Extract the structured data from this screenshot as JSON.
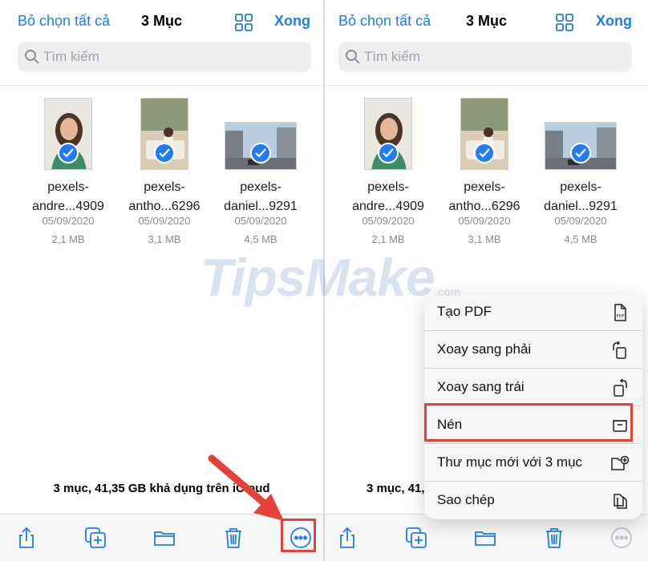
{
  "colors": {
    "accent": "#1f7cf2",
    "highlight": "#e5413a",
    "secondary_text": "#8a8a8e"
  },
  "header": {
    "deselect_all": "Bỏ chọn tất cả",
    "title": "3 Mục",
    "done": "Xong"
  },
  "search": {
    "placeholder": "Tìm kiếm"
  },
  "files": [
    {
      "name_line1": "pexels-",
      "name_line2": "andre...4909",
      "date": "05/09/2020",
      "size": "2,1 MB",
      "selected": true
    },
    {
      "name_line1": "pexels-",
      "name_line2": "antho...6296",
      "date": "05/09/2020",
      "size": "3,1 MB",
      "selected": true
    },
    {
      "name_line1": "pexels-",
      "name_line2": "daniel...9291",
      "date": "05/09/2020",
      "size": "4,5 MB",
      "selected": true
    }
  ],
  "storage_text": "3 mục, 41,35 GB khả dụng trên iCloud",
  "storage_text_truncated": "3 mục, 41,",
  "toolbar": {
    "icons": [
      "share-icon",
      "duplicate-icon",
      "folder-icon",
      "trash-icon",
      "more-icon"
    ]
  },
  "menu": {
    "items": [
      {
        "label": "Tạo PDF",
        "icon": "pdf-icon"
      },
      {
        "label": "Xoay sang phải",
        "icon": "rotate-right-icon"
      },
      {
        "label": "Xoay sang trái",
        "icon": "rotate-left-icon"
      },
      {
        "label": "Nén",
        "icon": "archive-icon"
      },
      {
        "label": "Thư mục mới với 3 mục",
        "icon": "new-folder-icon"
      },
      {
        "label": "Sao chép",
        "icon": "copy-icon"
      }
    ]
  },
  "watermark": {
    "text": "TipsMake",
    "suffix": ".com"
  }
}
